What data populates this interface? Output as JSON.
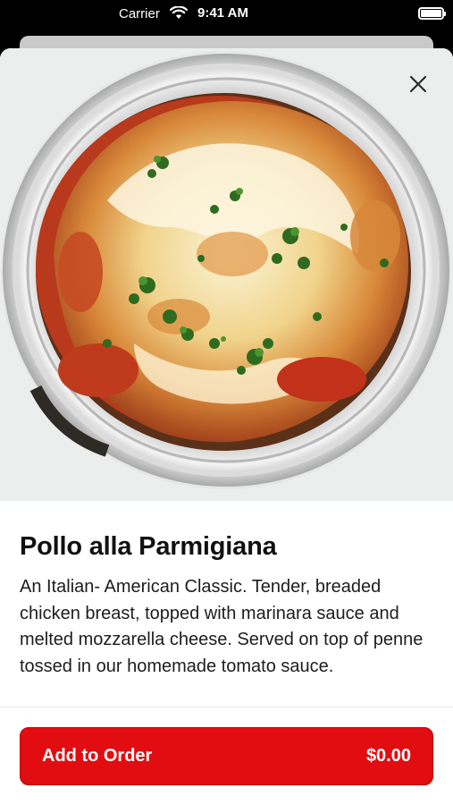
{
  "status_bar": {
    "carrier": "Carrier",
    "time": "9:41 AM"
  },
  "item": {
    "title": "Pollo alla Parmigiana",
    "description": "An Italian- American Classic. Tender, breaded chicken breast, topped with marinara sauce and melted mozzarella cheese. Served on top of penne tossed in our homemade tomato sauce."
  },
  "actions": {
    "add_label": "Add to Order",
    "price": "$0.00"
  },
  "colors": {
    "accent": "#e10d11"
  },
  "icons": [
    "wifi-icon",
    "battery-icon",
    "close-icon"
  ]
}
